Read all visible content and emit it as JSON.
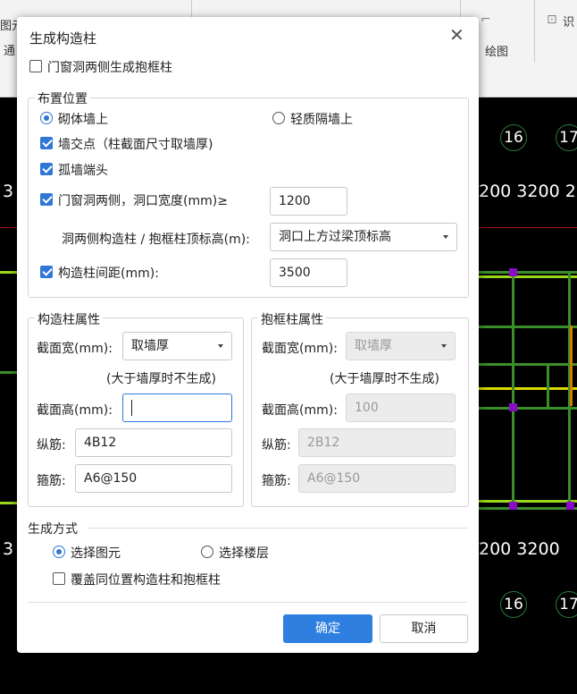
{
  "background": {
    "ribbon": {
      "left_fragment": "图元",
      "row2_fragment": "通",
      "draw_label": "绘图",
      "right_fragment": "识"
    },
    "cad": {
      "axis_top_left": "16",
      "axis_top_right": "17",
      "axis_bottom_left": "16",
      "axis_bottom_right": "17",
      "dim_top": "200  3200 2",
      "dim_bottom": "200  3200",
      "edge_num_top": "3",
      "edge_num_bottom": "3"
    }
  },
  "dialog": {
    "title": "生成构造柱",
    "top_checkbox": {
      "label": "门窗洞两侧生成抱框柱",
      "checked": false
    },
    "placement": {
      "legend": "布置位置",
      "radio_masonry": {
        "label": "砌体墙上",
        "checked": true
      },
      "radio_light": {
        "label": "轻质隔墙上",
        "checked": false
      },
      "cb_wall_intersection": {
        "label": "墙交点（柱截面尺寸取墙厚)",
        "checked": true
      },
      "cb_isolated_end": {
        "label": "孤墙端头",
        "checked": true
      },
      "cb_door_window": {
        "label": "门窗洞两侧，洞口宽度(mm)≥",
        "checked": true,
        "value": "1200"
      },
      "top_elev_label": "洞两侧构造柱 / 抱框柱顶标高(m):",
      "top_elev_value": "洞口上方过梁顶标高",
      "cb_spacing": {
        "label": "构造柱间距(mm):",
        "checked": true,
        "value": "3500"
      }
    },
    "column_props": {
      "legend": "构造柱属性",
      "width_label": "截面宽(mm):",
      "width_value": "取墙厚",
      "note": "(大于墙厚时不生成)",
      "height_label": "截面高(mm):",
      "height_value": "",
      "long_bar_label": "纵筋:",
      "long_bar_value": "4B12",
      "stirrup_label": "箍筋:",
      "stirrup_value": "A6@150"
    },
    "frame_props": {
      "legend": "抱框柱属性",
      "width_label": "截面宽(mm):",
      "width_value": "取墙厚",
      "note": "(大于墙厚时不生成)",
      "height_label": "截面高(mm):",
      "height_value": "100",
      "long_bar_label": "纵筋:",
      "long_bar_value": "2B12",
      "stirrup_label": "箍筋:",
      "stirrup_value": "A6@150"
    },
    "generate_mode": {
      "legend": "生成方式",
      "radio_select_elem": {
        "label": "选择图元",
        "checked": true
      },
      "radio_select_floor": {
        "label": "选择楼层",
        "checked": false
      },
      "cb_overwrite": {
        "label": "覆盖同位置构造柱和抱框柱",
        "checked": false
      }
    },
    "ok_label": "确定",
    "cancel_label": "取消"
  },
  "colors": {
    "accent": "#2f7fe0",
    "cad_green": "#3a8f2a",
    "cad_yellow": "#d9d900",
    "cad_node": "#8a0ac8"
  }
}
